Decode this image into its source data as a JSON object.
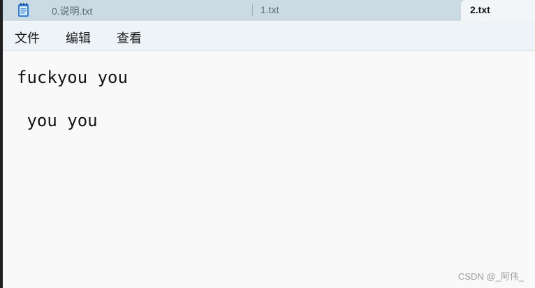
{
  "tabs": [
    {
      "label": "0.说明.txt",
      "active": false,
      "icon": "notepad-icon"
    },
    {
      "label": "1.txt",
      "active": false
    },
    {
      "label": "2.txt",
      "active": true
    }
  ],
  "menu": {
    "file": "文件",
    "edit": "编辑",
    "view": "查看"
  },
  "editor": {
    "lines": [
      "fuckyou you",
      " you you"
    ]
  },
  "watermark": "CSDN @_阿伟_",
  "colors": {
    "tabbar": "#ccdbe3",
    "active_tab": "#f3f6f9",
    "menubar": "#eef3f7",
    "editor_bg": "#f9f9f9",
    "outer_bg": "#202020"
  }
}
